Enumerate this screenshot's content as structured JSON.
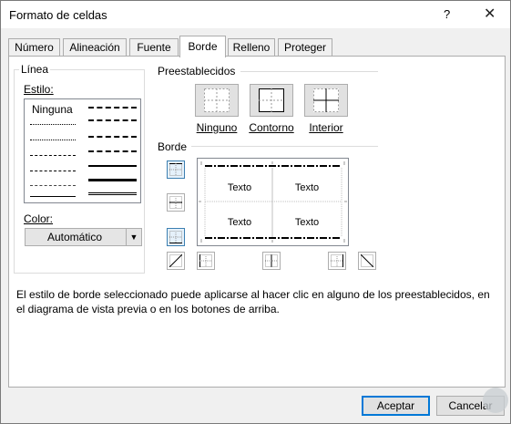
{
  "dialog": {
    "title": "Formato de celdas",
    "help": "?",
    "close": "✕"
  },
  "tabs": [
    {
      "label": "Número",
      "active": false
    },
    {
      "label": "Alineación",
      "active": false
    },
    {
      "label": "Fuente",
      "active": false
    },
    {
      "label": "Borde",
      "active": true
    },
    {
      "label": "Relleno",
      "active": false
    },
    {
      "label": "Proteger",
      "active": false
    }
  ],
  "line_group": {
    "title": "Línea",
    "style_label": "Estilo:",
    "none_option": "Ninguna",
    "color_label": "Color:",
    "color_value": "Automático"
  },
  "presets": {
    "title": "Preestablecidos",
    "items": [
      "Ninguno",
      "Contorno",
      "Interior"
    ]
  },
  "border": {
    "title": "Borde",
    "cells": [
      "Texto",
      "Texto",
      "Texto",
      "Texto"
    ]
  },
  "description": "El estilo de borde seleccionado puede aplicarse al hacer clic en alguno de los preestablecidos, en el diagrama de vista previa o en los botones de arriba.",
  "buttons": {
    "accept": "Aceptar",
    "cancel": "Cancelar"
  },
  "colors": {
    "accent": "#0078d7",
    "active_border_button": "#3c7fb1",
    "panel_bg": "#ffffff",
    "dialog_bg": "#f0f0f0"
  }
}
